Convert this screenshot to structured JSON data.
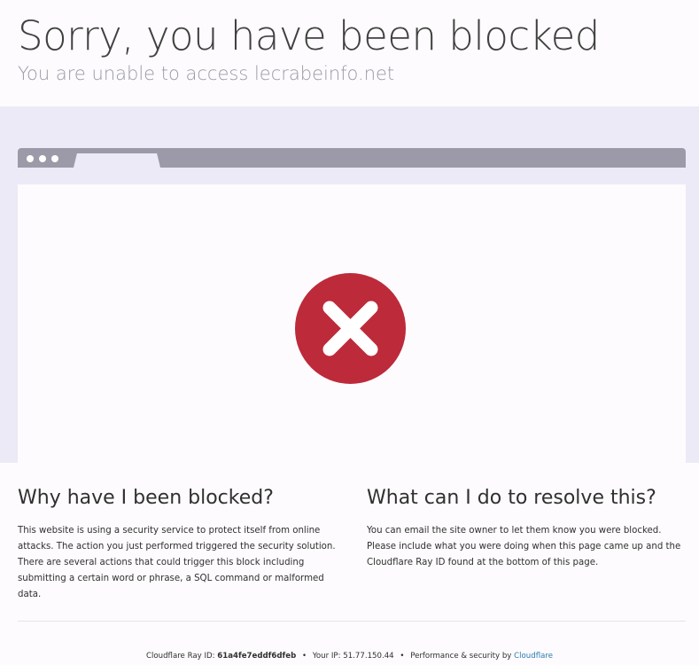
{
  "header": {
    "title": "Sorry, you have been blocked",
    "subtitle": "You are unable to access lecrabeinfo.net"
  },
  "illustration": {
    "icon": "error-x-icon",
    "icon_color": "#bd2a3a",
    "bar_color": "#9c9aa8",
    "background_color": "#eceaf6"
  },
  "why": {
    "heading": "Why have I been blocked?",
    "body": "This website is using a security service to protect itself from online attacks. The action you just performed triggered the security solution. There are several actions that could trigger this block including submitting a certain word or phrase, a SQL command or malformed data."
  },
  "resolve": {
    "heading": "What can I do to resolve this?",
    "body": "You can email the site owner to let them know you were blocked. Please include what you were doing when this page came up and the Cloudflare Ray ID found at the bottom of this page."
  },
  "footer": {
    "ray_label": "Cloudflare Ray ID:",
    "ray_id": "61a4fe7eddf6dfeb",
    "separator": "•",
    "ip_label": "Your IP:",
    "ip": "51.77.150.44",
    "perf_label": "Performance & security by",
    "cloudflare_link": "Cloudflare"
  }
}
